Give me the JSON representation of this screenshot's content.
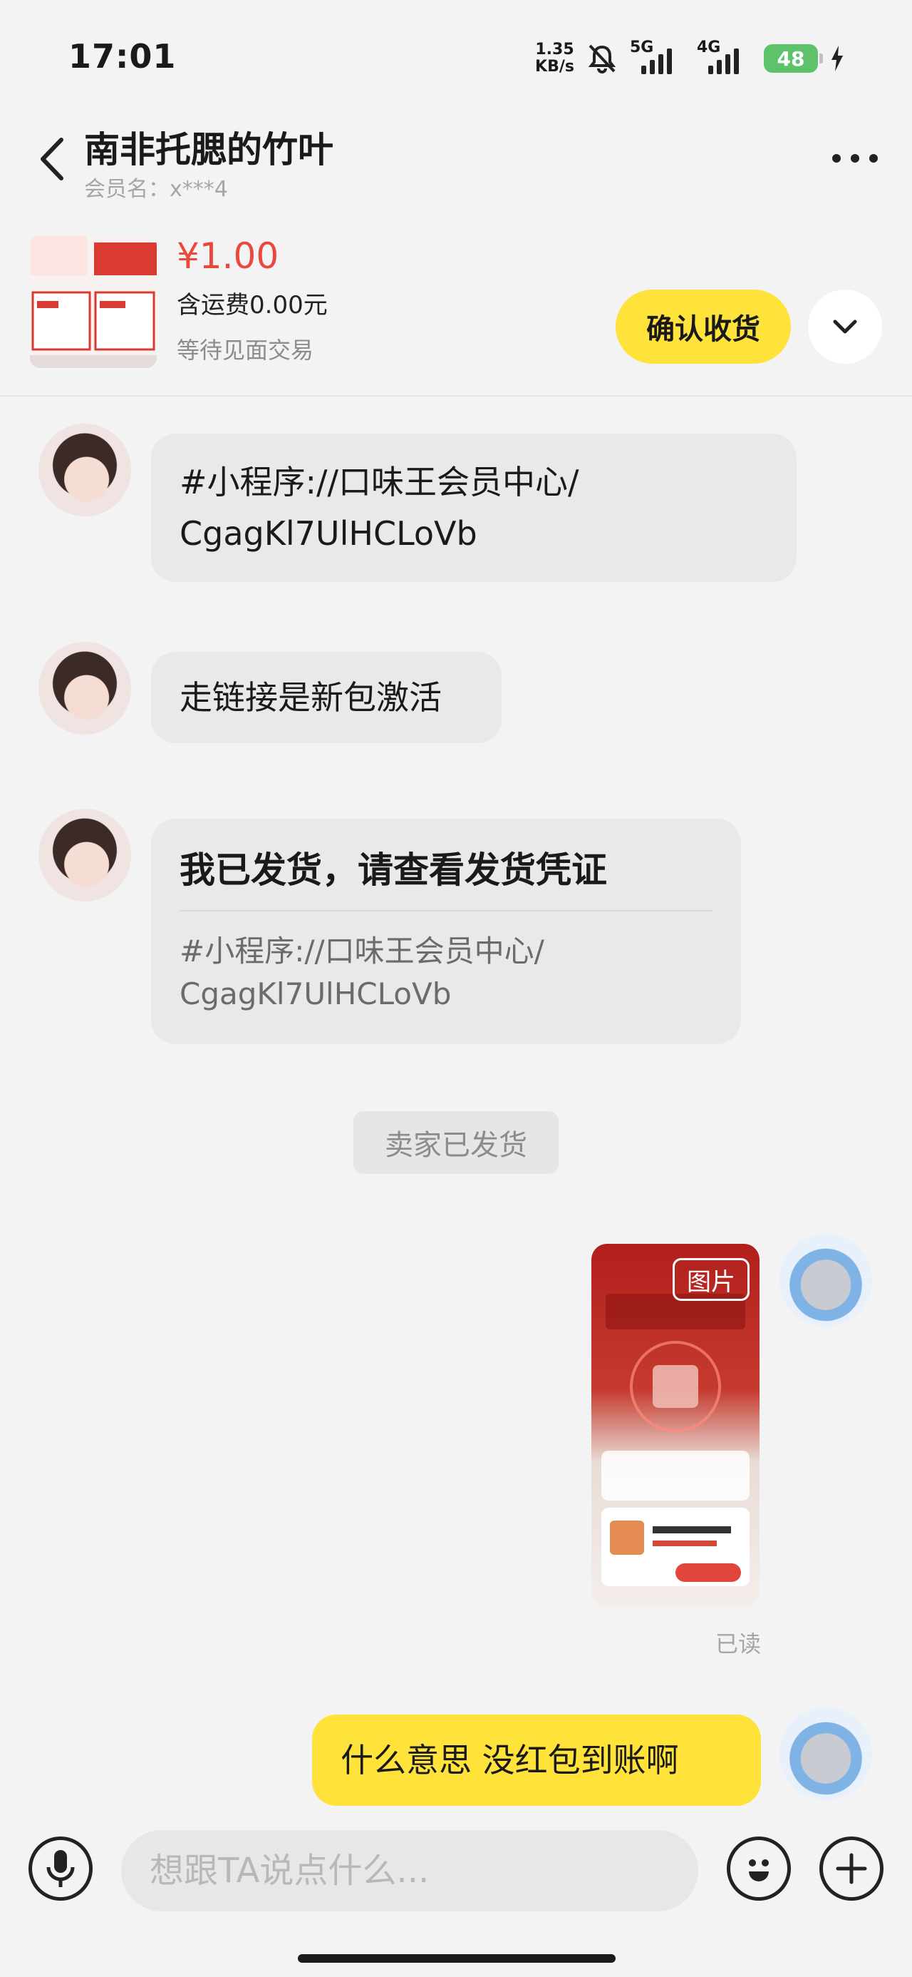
{
  "status_bar": {
    "time": "17:01",
    "speed_value": "1.35",
    "speed_unit": "KB/s",
    "sig1_label": "5G",
    "sig2_label": "4G",
    "battery": "48"
  },
  "header": {
    "title": "南非托腮的竹叶",
    "subtitle": "会员名：x***4"
  },
  "order": {
    "price": "¥1.00",
    "shipping": "含运费0.00元",
    "status": "等待见面交易",
    "confirm_label": "确认收货"
  },
  "messages": {
    "m1_text": "#小程序://口味王会员中心/ CgagKl7UlHCLoVb",
    "m2_text": "走链接是新包激活",
    "m3_title": "我已发货，请查看发货凭证",
    "m3_body": "#小程序://口味王会员中心/ CgagKl7UlHCLoVb",
    "system_notice": "卖家已发货",
    "image_label": "图片",
    "read_status": "已读",
    "m5_text": "什么意思  没红包到账啊"
  },
  "input": {
    "placeholder": "想跟TA说点什么..."
  },
  "colors": {
    "accent_yellow": "#ffe33b",
    "price_red": "#e9493d",
    "battery_green": "#5ec26a"
  },
  "icons": [
    "back-icon",
    "more-icon",
    "mute-icon",
    "signal-icon",
    "battery-icon",
    "charging-icon",
    "chevron-down-icon",
    "mic-icon",
    "emoji-icon",
    "plus-icon"
  ]
}
